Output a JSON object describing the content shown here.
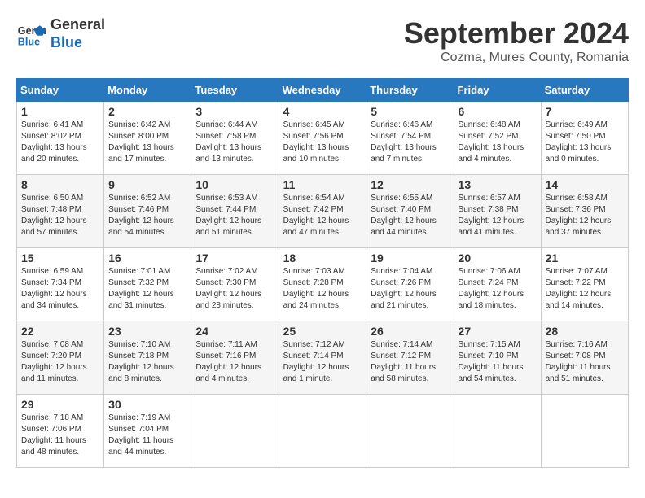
{
  "logo": {
    "line1": "General",
    "line2": "Blue"
  },
  "title": "September 2024",
  "location": "Cozma, Mures County, Romania",
  "days_of_week": [
    "Sunday",
    "Monday",
    "Tuesday",
    "Wednesday",
    "Thursday",
    "Friday",
    "Saturday"
  ],
  "weeks": [
    [
      {
        "day": "1",
        "sunrise": "Sunrise: 6:41 AM",
        "sunset": "Sunset: 8:02 PM",
        "daylight": "Daylight: 13 hours and 20 minutes."
      },
      {
        "day": "2",
        "sunrise": "Sunrise: 6:42 AM",
        "sunset": "Sunset: 8:00 PM",
        "daylight": "Daylight: 13 hours and 17 minutes."
      },
      {
        "day": "3",
        "sunrise": "Sunrise: 6:44 AM",
        "sunset": "Sunset: 7:58 PM",
        "daylight": "Daylight: 13 hours and 13 minutes."
      },
      {
        "day": "4",
        "sunrise": "Sunrise: 6:45 AM",
        "sunset": "Sunset: 7:56 PM",
        "daylight": "Daylight: 13 hours and 10 minutes."
      },
      {
        "day": "5",
        "sunrise": "Sunrise: 6:46 AM",
        "sunset": "Sunset: 7:54 PM",
        "daylight": "Daylight: 13 hours and 7 minutes."
      },
      {
        "day": "6",
        "sunrise": "Sunrise: 6:48 AM",
        "sunset": "Sunset: 7:52 PM",
        "daylight": "Daylight: 13 hours and 4 minutes."
      },
      {
        "day": "7",
        "sunrise": "Sunrise: 6:49 AM",
        "sunset": "Sunset: 7:50 PM",
        "daylight": "Daylight: 13 hours and 0 minutes."
      }
    ],
    [
      {
        "day": "8",
        "sunrise": "Sunrise: 6:50 AM",
        "sunset": "Sunset: 7:48 PM",
        "daylight": "Daylight: 12 hours and 57 minutes."
      },
      {
        "day": "9",
        "sunrise": "Sunrise: 6:52 AM",
        "sunset": "Sunset: 7:46 PM",
        "daylight": "Daylight: 12 hours and 54 minutes."
      },
      {
        "day": "10",
        "sunrise": "Sunrise: 6:53 AM",
        "sunset": "Sunset: 7:44 PM",
        "daylight": "Daylight: 12 hours and 51 minutes."
      },
      {
        "day": "11",
        "sunrise": "Sunrise: 6:54 AM",
        "sunset": "Sunset: 7:42 PM",
        "daylight": "Daylight: 12 hours and 47 minutes."
      },
      {
        "day": "12",
        "sunrise": "Sunrise: 6:55 AM",
        "sunset": "Sunset: 7:40 PM",
        "daylight": "Daylight: 12 hours and 44 minutes."
      },
      {
        "day": "13",
        "sunrise": "Sunrise: 6:57 AM",
        "sunset": "Sunset: 7:38 PM",
        "daylight": "Daylight: 12 hours and 41 minutes."
      },
      {
        "day": "14",
        "sunrise": "Sunrise: 6:58 AM",
        "sunset": "Sunset: 7:36 PM",
        "daylight": "Daylight: 12 hours and 37 minutes."
      }
    ],
    [
      {
        "day": "15",
        "sunrise": "Sunrise: 6:59 AM",
        "sunset": "Sunset: 7:34 PM",
        "daylight": "Daylight: 12 hours and 34 minutes."
      },
      {
        "day": "16",
        "sunrise": "Sunrise: 7:01 AM",
        "sunset": "Sunset: 7:32 PM",
        "daylight": "Daylight: 12 hours and 31 minutes."
      },
      {
        "day": "17",
        "sunrise": "Sunrise: 7:02 AM",
        "sunset": "Sunset: 7:30 PM",
        "daylight": "Daylight: 12 hours and 28 minutes."
      },
      {
        "day": "18",
        "sunrise": "Sunrise: 7:03 AM",
        "sunset": "Sunset: 7:28 PM",
        "daylight": "Daylight: 12 hours and 24 minutes."
      },
      {
        "day": "19",
        "sunrise": "Sunrise: 7:04 AM",
        "sunset": "Sunset: 7:26 PM",
        "daylight": "Daylight: 12 hours and 21 minutes."
      },
      {
        "day": "20",
        "sunrise": "Sunrise: 7:06 AM",
        "sunset": "Sunset: 7:24 PM",
        "daylight": "Daylight: 12 hours and 18 minutes."
      },
      {
        "day": "21",
        "sunrise": "Sunrise: 7:07 AM",
        "sunset": "Sunset: 7:22 PM",
        "daylight": "Daylight: 12 hours and 14 minutes."
      }
    ],
    [
      {
        "day": "22",
        "sunrise": "Sunrise: 7:08 AM",
        "sunset": "Sunset: 7:20 PM",
        "daylight": "Daylight: 12 hours and 11 minutes."
      },
      {
        "day": "23",
        "sunrise": "Sunrise: 7:10 AM",
        "sunset": "Sunset: 7:18 PM",
        "daylight": "Daylight: 12 hours and 8 minutes."
      },
      {
        "day": "24",
        "sunrise": "Sunrise: 7:11 AM",
        "sunset": "Sunset: 7:16 PM",
        "daylight": "Daylight: 12 hours and 4 minutes."
      },
      {
        "day": "25",
        "sunrise": "Sunrise: 7:12 AM",
        "sunset": "Sunset: 7:14 PM",
        "daylight": "Daylight: 12 hours and 1 minute."
      },
      {
        "day": "26",
        "sunrise": "Sunrise: 7:14 AM",
        "sunset": "Sunset: 7:12 PM",
        "daylight": "Daylight: 11 hours and 58 minutes."
      },
      {
        "day": "27",
        "sunrise": "Sunrise: 7:15 AM",
        "sunset": "Sunset: 7:10 PM",
        "daylight": "Daylight: 11 hours and 54 minutes."
      },
      {
        "day": "28",
        "sunrise": "Sunrise: 7:16 AM",
        "sunset": "Sunset: 7:08 PM",
        "daylight": "Daylight: 11 hours and 51 minutes."
      }
    ],
    [
      {
        "day": "29",
        "sunrise": "Sunrise: 7:18 AM",
        "sunset": "Sunset: 7:06 PM",
        "daylight": "Daylight: 11 hours and 48 minutes."
      },
      {
        "day": "30",
        "sunrise": "Sunrise: 7:19 AM",
        "sunset": "Sunset: 7:04 PM",
        "daylight": "Daylight: 11 hours and 44 minutes."
      },
      null,
      null,
      null,
      null,
      null
    ]
  ]
}
